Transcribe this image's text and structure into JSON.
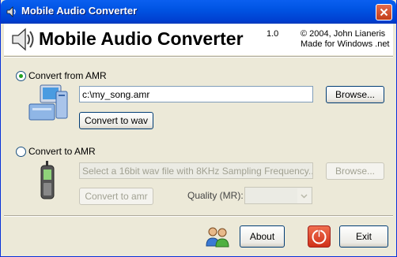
{
  "window": {
    "title": "Mobile Audio Converter"
  },
  "header": {
    "title": "Mobile Audio Converter",
    "version": "1.0",
    "copyright": "© 2004, John Lianeris",
    "made_for": "Made for Windows .net"
  },
  "from_amr": {
    "label": "Convert from AMR",
    "selected": true,
    "file_value": "c:\\my_song.amr",
    "browse_label": "Browse...",
    "convert_label": "Convert to wav"
  },
  "to_amr": {
    "label": "Convert to AMR",
    "selected": false,
    "file_placeholder": "Select a 16bit wav file with 8KHz Sampling Frequency...",
    "browse_label": "Browse...",
    "convert_label": "Convert to amr",
    "quality_label": "Quality (MR):",
    "quality_value": ""
  },
  "footer": {
    "about_label": "About",
    "exit_label": "Exit"
  },
  "icons": {
    "app": "speaker-icon",
    "computer": "computer-icon",
    "phone": "mobile-phone-icon",
    "users": "users-icon",
    "power": "power-icon"
  },
  "colors": {
    "titlebar": "#0054e3",
    "power_red": "#e03a1e",
    "radio_dot": "#21a121"
  }
}
